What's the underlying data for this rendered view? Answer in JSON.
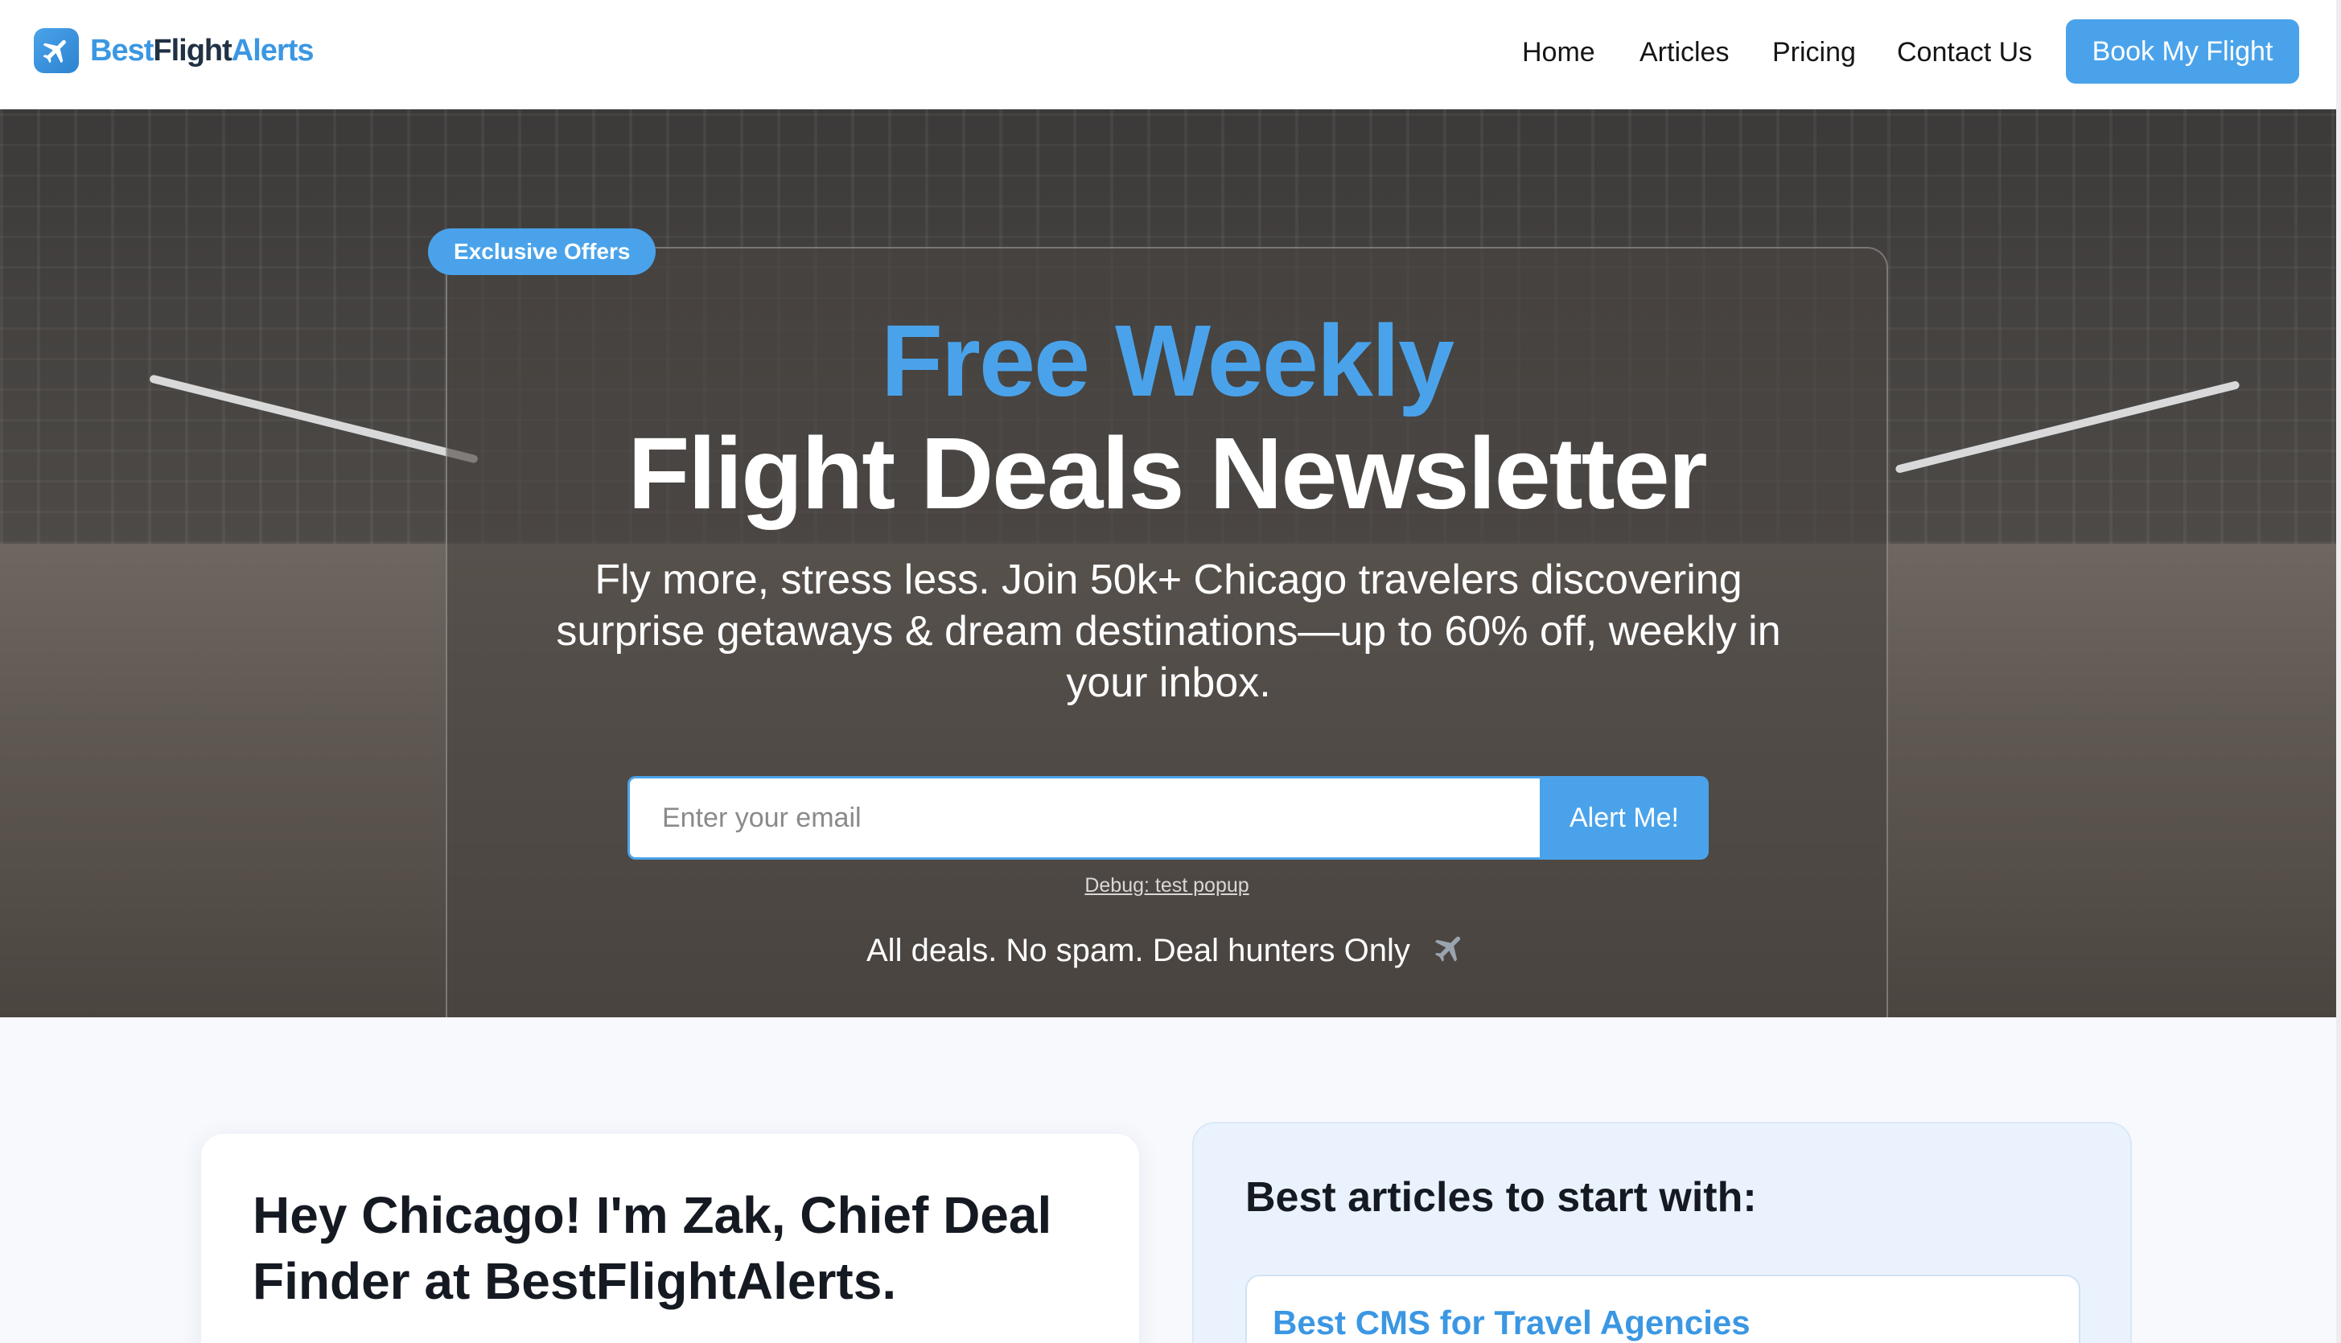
{
  "brand": {
    "name_part1": "Best",
    "name_part2": "Flight",
    "name_part3": "Alerts",
    "logo_icon": "airplane-icon",
    "accent_color": "#4aa3ea"
  },
  "nav": {
    "home": "Home",
    "articles": "Articles",
    "pricing": "Pricing",
    "contact": "Contact Us",
    "cta": "Book My Flight"
  },
  "hero": {
    "badge": "Exclusive Offers",
    "title_line1": "Free Weekly",
    "title_line2": "Flight Deals Newsletter",
    "subtitle": "Fly more, stress less. Join 50k+ Chicago travelers discovering surprise getaways & dream destinations—up to 60% off, weekly in your inbox.",
    "email_placeholder": "Enter your email",
    "email_value": "",
    "submit_label": "Alert Me!",
    "debug_link": "Debug: test popup",
    "tagline": "All deals. No spam. Deal hunters Only",
    "tagline_icon": "airplane-icon"
  },
  "intro": {
    "heading": "Hey Chicago! I'm Zak, Chief Deal Finder at BestFlightAlerts."
  },
  "articles": {
    "heading": "Best articles to start with:",
    "items": [
      {
        "title": "Best CMS for Travel Agencies"
      }
    ]
  }
}
